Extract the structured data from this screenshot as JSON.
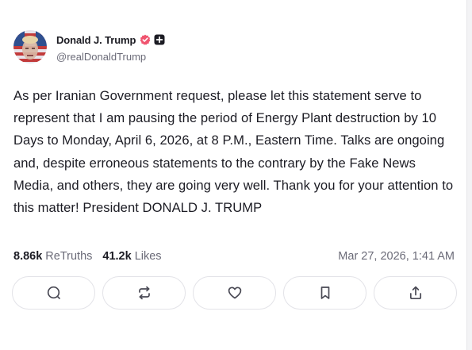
{
  "author": {
    "display_name": "Donald J. Trump",
    "handle": "@realDonaldTrump",
    "verified_icon": "verified-badge-icon",
    "verified_color": "#f0546f",
    "extra_badge_icon": "plus-badge-icon"
  },
  "post": {
    "text": "As per Iranian Government request, please let this statement serve to represent that I am pausing the period of Energy Plant destruction by 10 Days to Monday, April 6, 2026, at 8 P.M., Eastern Time. Talks are ongoing and, despite erroneous statements to the contrary by the Fake News Media, and others, they are going very well. Thank you for your attention to this matter! President DONALD J. TRUMP"
  },
  "stats": {
    "retruths_count": "8.86k",
    "retruths_label": "ReTruths",
    "likes_count": "41.2k",
    "likes_label": "Likes",
    "timestamp": "Mar 27, 2026, 1:41 AM"
  },
  "actions": [
    {
      "name": "reply",
      "icon": "comment-icon"
    },
    {
      "name": "retruth",
      "icon": "repost-icon"
    },
    {
      "name": "like",
      "icon": "heart-icon"
    },
    {
      "name": "bookmark",
      "icon": "bookmark-icon"
    },
    {
      "name": "share",
      "icon": "share-icon"
    }
  ],
  "colors": {
    "text_primary": "#1c1c24",
    "text_secondary": "#6b6b78",
    "border": "#e3e3e8"
  }
}
